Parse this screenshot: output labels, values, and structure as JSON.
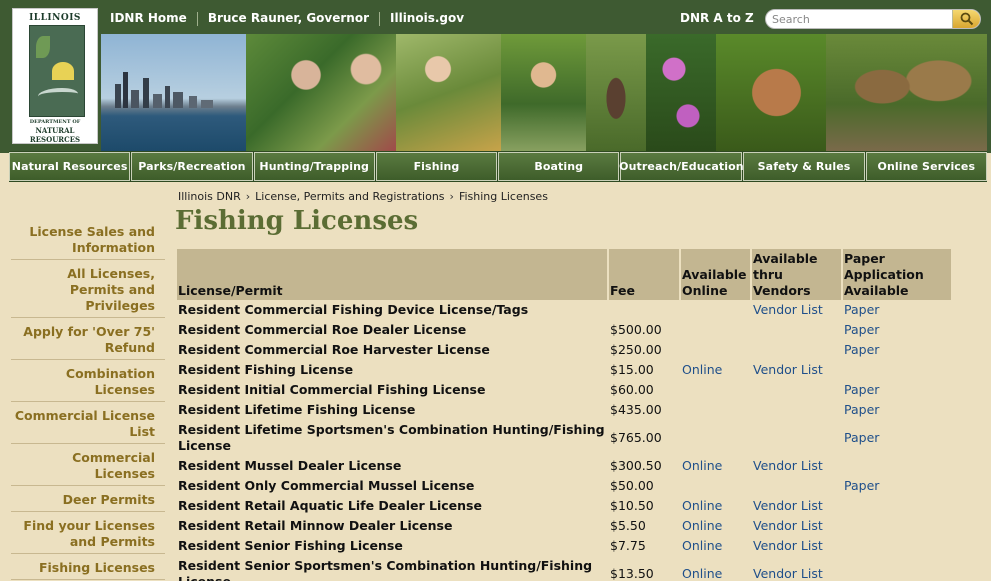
{
  "logo": {
    "line1": "ILLINOIS",
    "line2": "DEPARTMENT OF",
    "line3": "NATURAL",
    "line4": "RESOURCES"
  },
  "top_links": [
    "IDNR Home",
    "Bruce Rauner, Governor",
    "Illinois.gov"
  ],
  "atoz": "DNR A to Z",
  "search": {
    "placeholder": "Search"
  },
  "nav": [
    "Natural Resources",
    "Parks/Recreation",
    "Hunting/Trapping",
    "Fishing",
    "Boating",
    "Outreach/Education",
    "Safety & Rules",
    "Online Services"
  ],
  "sidebar": [
    "License Sales and Information",
    "All Licenses, Permits and Privileges",
    "Apply for 'Over 75' Refund",
    "Combination Licenses",
    "Commercial License List",
    "Commercial Licenses",
    "Deer Permits",
    "Find your Licenses and Permits",
    "Fishing Licenses"
  ],
  "breadcrumb": [
    "Illinois DNR",
    "License, Permits and Registrations",
    "Fishing Licenses"
  ],
  "page_title": "Fishing Licenses",
  "table": {
    "headers": [
      "License/Permit",
      "Fee",
      "Available Online",
      "Available thru Vendors",
      "Paper Application Available"
    ],
    "rows": [
      {
        "name": "Resident Commercial Fishing Device License/Tags",
        "fee": "",
        "online": "",
        "vendor": "Vendor List",
        "paper": "Paper"
      },
      {
        "name": "Resident Commercial Roe Dealer License",
        "fee": "$500.00",
        "online": "",
        "vendor": "",
        "paper": "Paper"
      },
      {
        "name": "Resident Commercial Roe Harvester License",
        "fee": "$250.00",
        "online": "",
        "vendor": "",
        "paper": "Paper"
      },
      {
        "name": "Resident Fishing License",
        "fee": "$15.00",
        "online": "Online",
        "vendor": "Vendor List",
        "paper": ""
      },
      {
        "name": "Resident Initial Commercial Fishing License",
        "fee": "$60.00",
        "online": "",
        "vendor": "",
        "paper": "Paper"
      },
      {
        "name": "Resident Lifetime Fishing License",
        "fee": "$435.00",
        "online": "",
        "vendor": "",
        "paper": "Paper"
      },
      {
        "name": "Resident Lifetime Sportsmen's Combination Hunting/Fishing License",
        "fee": "$765.00",
        "online": "",
        "vendor": "",
        "paper": "Paper"
      },
      {
        "name": "Resident Mussel Dealer License",
        "fee": "$300.50",
        "online": "Online",
        "vendor": "Vendor List",
        "paper": ""
      },
      {
        "name": "Resident Only Commercial Mussel License",
        "fee": "$50.00",
        "online": "",
        "vendor": "",
        "paper": "Paper"
      },
      {
        "name": "Resident Retail Aquatic Life Dealer License",
        "fee": "$10.50",
        "online": "Online",
        "vendor": "Vendor List",
        "paper": ""
      },
      {
        "name": "Resident Retail Minnow Dealer License",
        "fee": "$5.50",
        "online": "Online",
        "vendor": "Vendor List",
        "paper": ""
      },
      {
        "name": "Resident Senior Fishing License",
        "fee": "$7.75",
        "online": "Online",
        "vendor": "Vendor List",
        "paper": ""
      },
      {
        "name": "Resident Senior Sportsmen's Combination Hunting/Fishing License",
        "fee": "$13.50",
        "online": "Online",
        "vendor": "Vendor List",
        "paper": ""
      }
    ]
  }
}
